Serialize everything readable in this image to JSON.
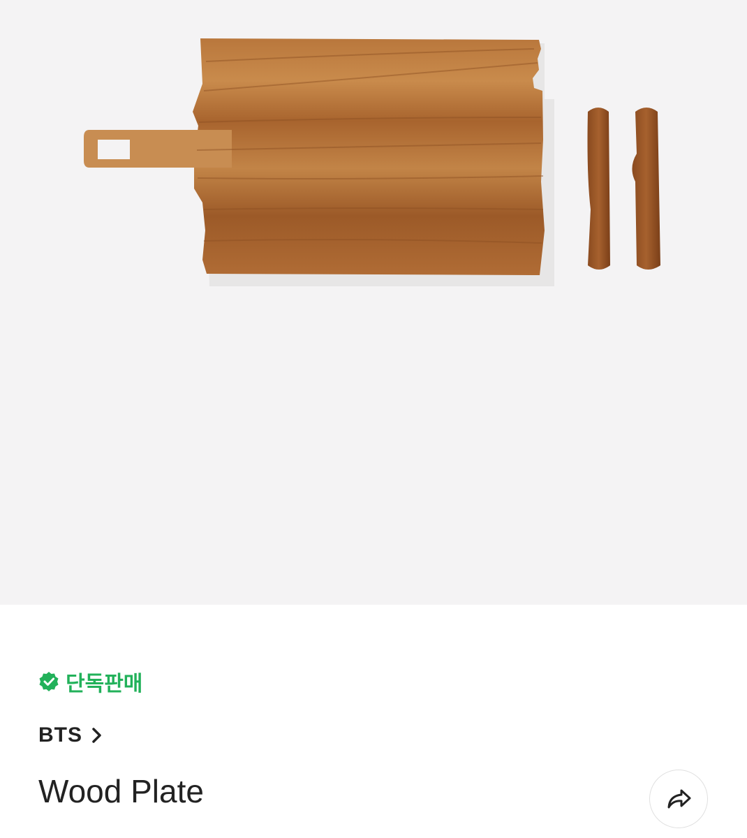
{
  "product_image": {
    "subject": "wood-plate-with-spreaders"
  },
  "badge": {
    "label": "단독판매",
    "icon": "verified-check-icon",
    "color": "#22b15a"
  },
  "brand": {
    "name": "BTS",
    "icon": "chevron-right-icon"
  },
  "product": {
    "title": "Wood Plate"
  },
  "actions": {
    "share_icon": "share-icon"
  }
}
